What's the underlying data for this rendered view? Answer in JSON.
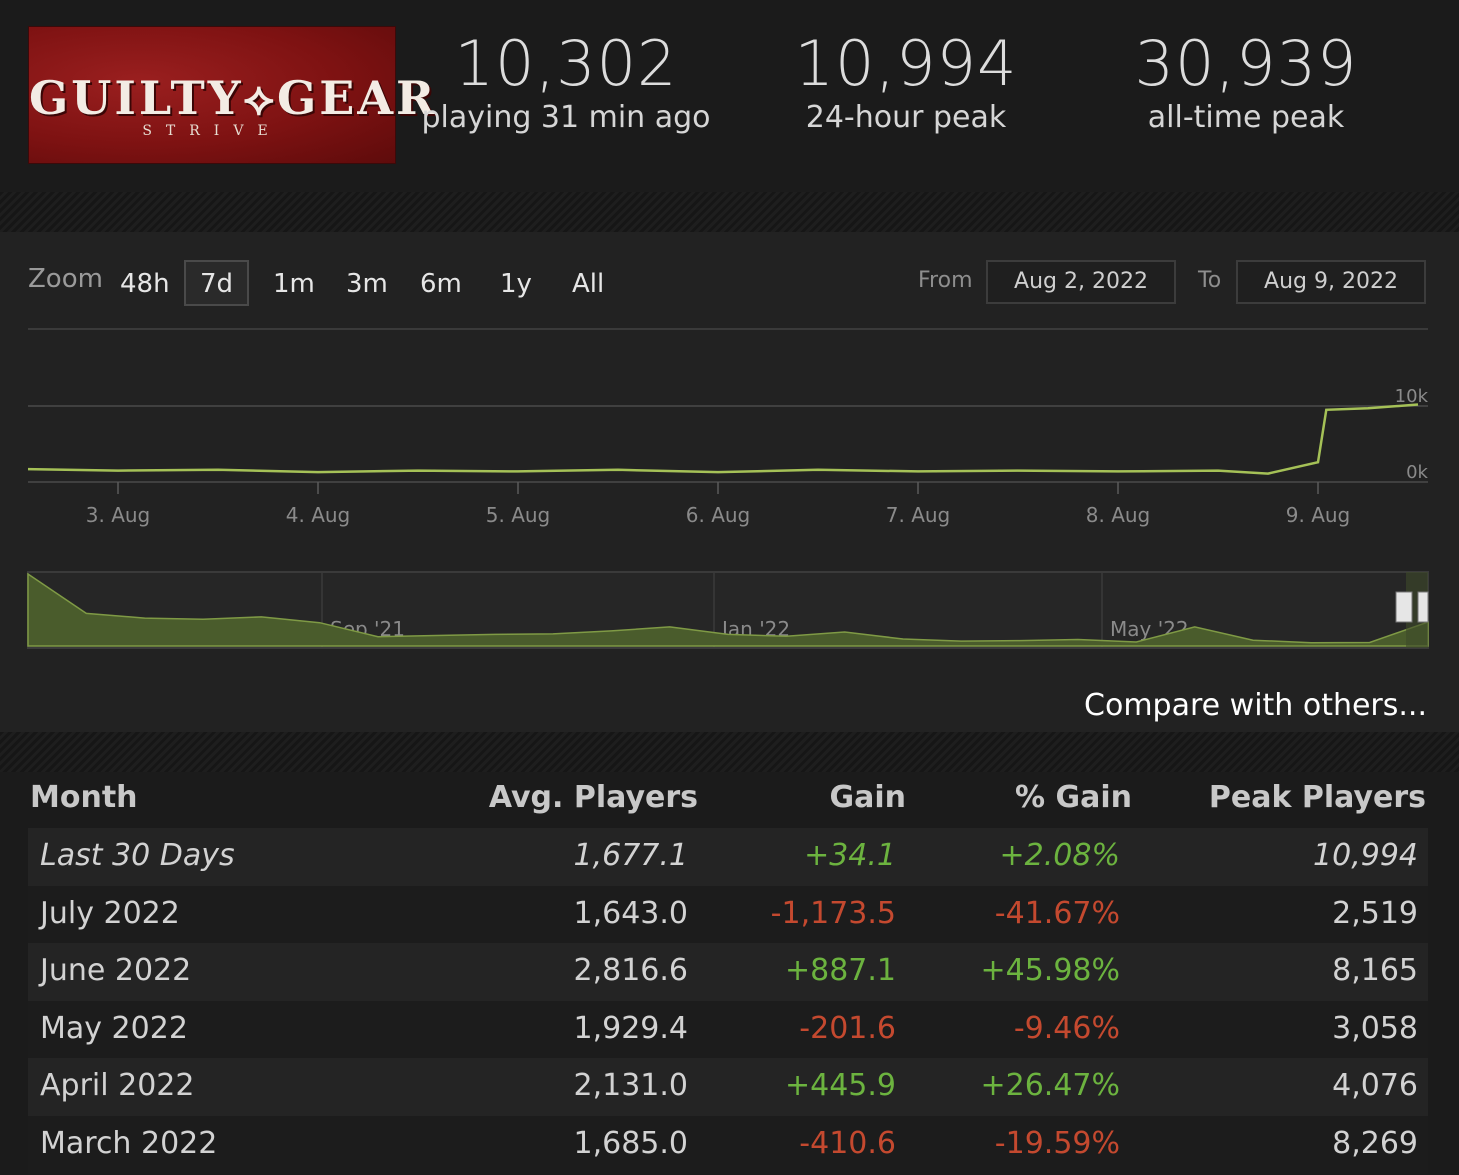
{
  "header": {
    "logo": {
      "title": "GUILTY⟡GEAR",
      "subtitle": "STRIVE"
    },
    "stats": [
      {
        "value": "10,302",
        "label": "playing 31 min ago"
      },
      {
        "value": "10,994",
        "label": "24-hour peak"
      },
      {
        "value": "30,939",
        "label": "all-time peak"
      }
    ]
  },
  "controls": {
    "zoom_label": "Zoom",
    "zoom_options": [
      "48h",
      "7d",
      "1m",
      "3m",
      "6m",
      "1y",
      "All"
    ],
    "active_zoom": "7d",
    "from_label": "From",
    "from_value": "Aug 2, 2022",
    "to_label": "To",
    "to_value": "Aug 9, 2022"
  },
  "chart_data": [
    {
      "type": "line",
      "x_ticks": [
        "3. Aug",
        "4. Aug",
        "5. Aug",
        "6. Aug",
        "7. Aug",
        "8. Aug",
        "9. Aug"
      ],
      "y_ticks": [
        "0k",
        "10k"
      ],
      "ylim": [
        0,
        10000
      ],
      "series": [
        {
          "color": "#a5c157",
          "x": [
            "Aug 2 12:00",
            "Aug 3 00:00",
            "Aug 3 12:00",
            "Aug 4 00:00",
            "Aug 4 12:00",
            "Aug 5 00:00",
            "Aug 5 12:00",
            "Aug 6 00:00",
            "Aug 6 12:00",
            "Aug 7 00:00",
            "Aug 7 12:00",
            "Aug 8 00:00",
            "Aug 8 12:00",
            "Aug 8 18:00",
            "Aug 9 00:00",
            "Aug 9 01:00",
            "Aug 9 06:00",
            "Aug 9 12:00"
          ],
          "values": [
            1700,
            1500,
            1600,
            1300,
            1500,
            1400,
            1600,
            1300,
            1600,
            1400,
            1500,
            1400,
            1500,
            1100,
            2600,
            9500,
            9700,
            10200
          ]
        }
      ]
    },
    {
      "type": "area",
      "x_ticks": [
        "Sep '21",
        "Jan '22",
        "May '22"
      ],
      "color": "#4a5c2c",
      "values": [
        30939,
        14000,
        12000,
        11500,
        12500,
        10000,
        4000,
        4500,
        5000,
        5200,
        6500,
        8200,
        5000,
        4200,
        6000,
        3000,
        2100,
        2300,
        2800,
        1700,
        8200,
        2500,
        1400,
        1500,
        10302
      ]
    }
  ],
  "compare_link": "Compare with others...",
  "table": {
    "headers": [
      "Month",
      "Avg. Players",
      "Gain",
      "% Gain",
      "Peak Players"
    ],
    "rows": [
      {
        "month": "Last 30 Days",
        "avg": "1,677.1",
        "gain": "+34.1",
        "pct": "+2.08%",
        "peak": "10,994",
        "dir": "pos",
        "italic": true
      },
      {
        "month": "July 2022",
        "avg": "1,643.0",
        "gain": "-1,173.5",
        "pct": "-41.67%",
        "peak": "2,519",
        "dir": "neg",
        "italic": false
      },
      {
        "month": "June 2022",
        "avg": "2,816.6",
        "gain": "+887.1",
        "pct": "+45.98%",
        "peak": "8,165",
        "dir": "pos",
        "italic": false
      },
      {
        "month": "May 2022",
        "avg": "1,929.4",
        "gain": "-201.6",
        "pct": "-9.46%",
        "peak": "3,058",
        "dir": "neg",
        "italic": false
      },
      {
        "month": "April 2022",
        "avg": "2,131.0",
        "gain": "+445.9",
        "pct": "+26.47%",
        "peak": "4,076",
        "dir": "pos",
        "italic": false
      },
      {
        "month": "March 2022",
        "avg": "1,685.0",
        "gain": "-410.6",
        "pct": "-19.59%",
        "peak": "8,269",
        "dir": "neg",
        "italic": false
      }
    ]
  }
}
